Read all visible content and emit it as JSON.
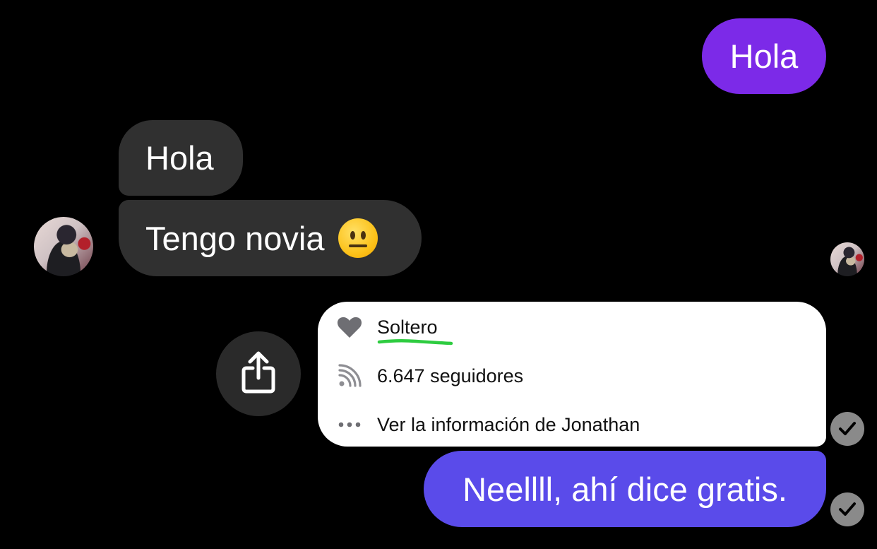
{
  "messages": {
    "outgoing_1": "Hola",
    "incoming_1": "Hola",
    "incoming_2": "Tengo novia",
    "incoming_2_emoji": "neutral-face-emoji",
    "outgoing_2": "Neellll, ahí dice gratis."
  },
  "profile_card": {
    "status": "Soltero",
    "followers": "6.647 seguidores",
    "more_info": "Ver la información de Jonathan"
  },
  "icons": {
    "share": "share-icon",
    "heart": "heart-icon",
    "rss": "rss-icon",
    "more": "more-dots-icon",
    "check": "check-icon"
  },
  "colors": {
    "background": "#000000",
    "outgoing_purple": "#7c2ae8",
    "outgoing_blue": "#5a4bea",
    "incoming_gray": "#303030",
    "underline_green": "#2ecc40",
    "check_gray": "#8a8a8a"
  }
}
